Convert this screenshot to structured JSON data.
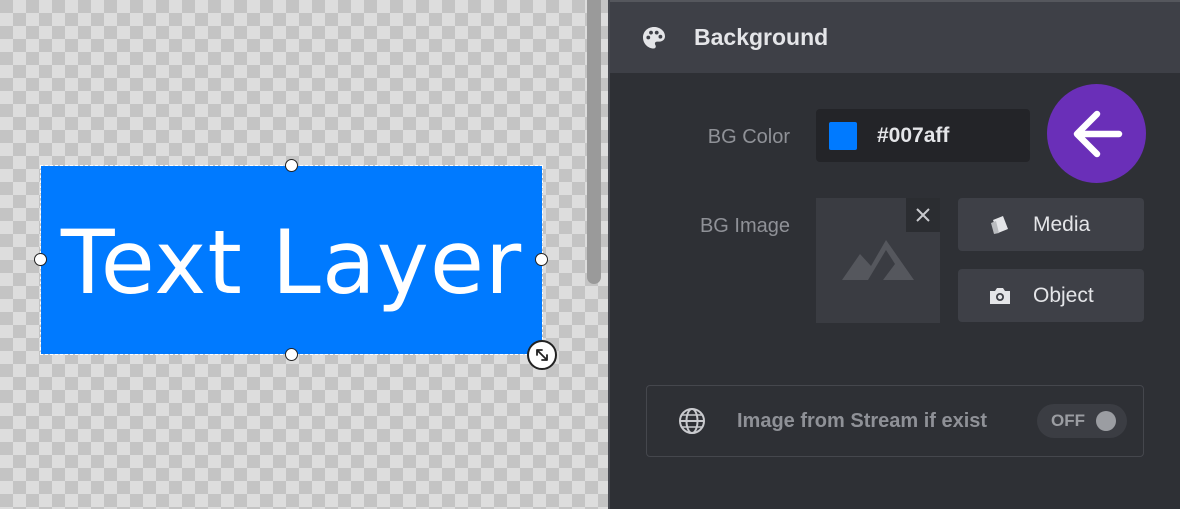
{
  "canvas": {
    "layer_text": "Text Layer",
    "layer_color": "#007aff"
  },
  "panel": {
    "title": "Background",
    "title_icon": "palette-icon",
    "bg_color": {
      "label": "BG Color",
      "value": "#007aff",
      "swatch_color": "#007aff"
    },
    "bg_image": {
      "label": "BG Image",
      "placeholder_icon": "mountain-image-icon",
      "clear_icon": "close-icon",
      "buttons": [
        {
          "label": "Media",
          "icon": "media-cards-icon"
        },
        {
          "label": "Object",
          "icon": "camera-icon"
        }
      ]
    },
    "stream": {
      "label": "Image from Stream if exist",
      "icon": "globe-icon",
      "toggle": "OFF"
    }
  },
  "overlay": {
    "arrow_icon": "arrow-left-icon",
    "accent_color": "#6a2fb8"
  }
}
